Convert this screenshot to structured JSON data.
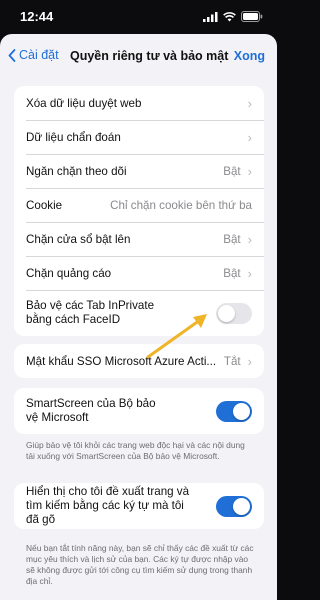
{
  "status_bar": {
    "time": "12:44"
  },
  "nav": {
    "back_label": "Cài đặt",
    "title": "Quyền riêng tư và bảo mật",
    "done_label": "Xong"
  },
  "group1": {
    "rows": [
      {
        "label": "Xóa dữ liệu duyệt web",
        "value": ""
      },
      {
        "label": "Dữ liệu chẩn đoán",
        "value": ""
      },
      {
        "label": "Ngăn chặn theo dõi",
        "value": "Bật"
      },
      {
        "label": "Cookie",
        "value": "Chỉ chặn cookie bên thứ ba"
      },
      {
        "label": "Chặn cửa sổ bật lên",
        "value": "Bật"
      },
      {
        "label": "Chặn quảng cáo",
        "value": "Bật"
      }
    ],
    "inprivate": {
      "label": "Bảo vệ các Tab InPrivate bằng cách FaceID",
      "enabled": false
    }
  },
  "group2": {
    "label": "Mật khẩu SSO Microsoft Azure Acti...",
    "value": "Tắt"
  },
  "group3": {
    "label": "SmartScreen của Bộ bảo vệ Microsoft",
    "enabled": true,
    "footer": "Giúp bảo vệ tôi khỏi các trang web độc hại và các nội dung tải xuống với SmartScreen của Bộ bảo vệ Microsoft."
  },
  "group4": {
    "label": "Hiển thị cho tôi đề xuất trang và tìm kiếm bằng các ký tự mà tôi đã gõ",
    "enabled": true,
    "footer": "Nếu bạn tắt tính năng này, bạn sẽ chỉ thấy các đề xuất từ các mục yêu thích và lịch sử của bạn. Các ký tự được nhập vào sẽ không được gửi tới công cụ tìm kiếm sử dụng trong thanh địa chỉ."
  },
  "colors": {
    "accent": "#1f6fd6",
    "annotation_arrow": "#f0b429"
  }
}
